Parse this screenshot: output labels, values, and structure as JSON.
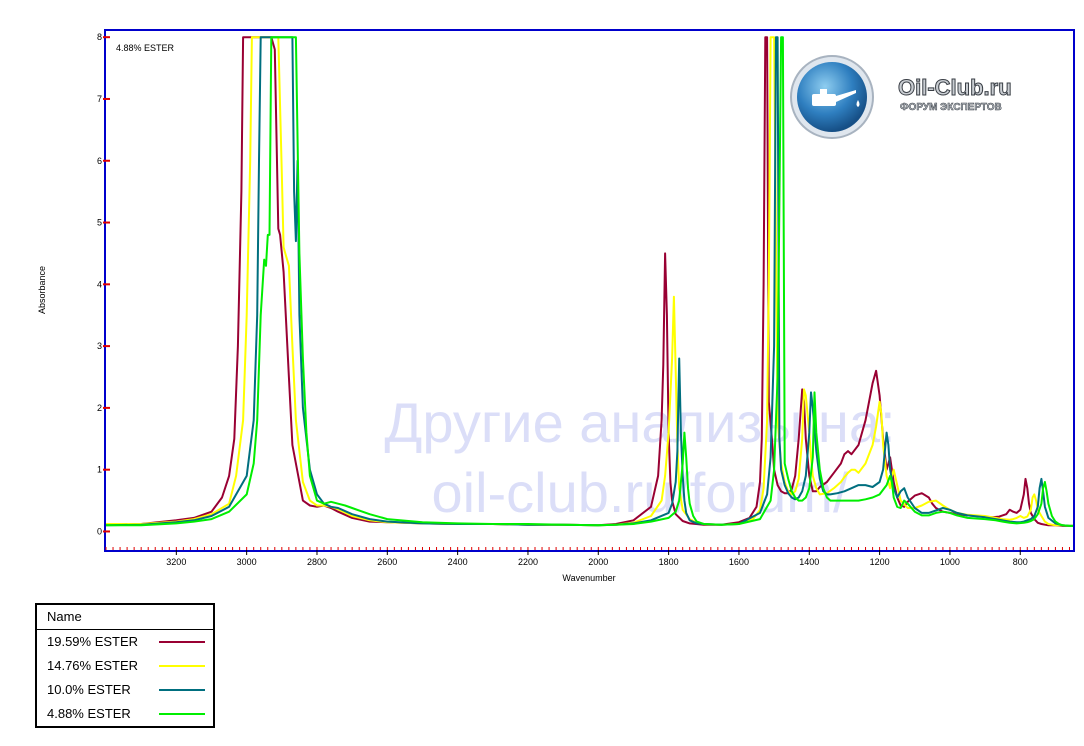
{
  "chart_data": {
    "type": "line",
    "subtitle": "4.88% ESTER",
    "xlabel": "Wavenumber",
    "ylabel": "Absorbance",
    "xlim": [
      3400,
      650
    ],
    "ylim": [
      -0.3,
      8.1
    ],
    "x_ticks": [
      3200,
      3000,
      2800,
      2600,
      2400,
      2200,
      2000,
      1800,
      1600,
      1400,
      1200,
      1000,
      800
    ],
    "y_ticks": [
      0,
      1,
      2,
      3,
      4,
      5,
      6,
      7,
      8
    ],
    "grid": false,
    "legend_title": "Name",
    "legend_position": "below-left",
    "watermark": [
      "Другие анализы на:",
      "oil-club.ru/forum/"
    ],
    "logo": {
      "name": "Oil-Club.ru",
      "tagline": "ФОРУМ ЭКСПЕРТОВ",
      "icon": "oil-can-icon"
    },
    "series": [
      {
        "name": "19.59% ESTER",
        "color": "#990033",
        "x": [
          3400,
          3300,
          3200,
          3150,
          3100,
          3070,
          3050,
          3035,
          3025,
          3015,
          3010,
          2930,
          2920,
          2910,
          2905,
          2895,
          2880,
          2870,
          2850,
          2840,
          2820,
          2800,
          2780,
          2760,
          2740,
          2700,
          2650,
          2600,
          2500,
          2400,
          2300,
          2200,
          2100,
          2000,
          1950,
          1900,
          1850,
          1830,
          1820,
          1815,
          1810,
          1805,
          1800,
          1795,
          1790,
          1780,
          1760,
          1740,
          1700,
          1650,
          1600,
          1570,
          1550,
          1540,
          1535,
          1530,
          1525,
          1520,
          1515,
          1505,
          1500,
          1490,
          1480,
          1470,
          1460,
          1450,
          1440,
          1430,
          1420,
          1415,
          1410,
          1400,
          1390,
          1380,
          1370,
          1350,
          1330,
          1310,
          1300,
          1290,
          1280,
          1260,
          1240,
          1220,
          1210,
          1200,
          1190,
          1180,
          1175,
          1170,
          1160,
          1150,
          1140,
          1130,
          1120,
          1100,
          1080,
          1060,
          1050,
          1040,
          1020,
          1000,
          980,
          950,
          900,
          880,
          860,
          840,
          830,
          820,
          810,
          800,
          790,
          785,
          780,
          775,
          770,
          760,
          750,
          740,
          730,
          720,
          700,
          680,
          660,
          650
        ],
        "y": [
          0.12,
          0.12,
          0.18,
          0.22,
          0.32,
          0.55,
          0.9,
          1.5,
          3.0,
          5.5,
          8,
          8,
          7.8,
          4.9,
          4.8,
          4.2,
          2.5,
          1.4,
          0.8,
          0.5,
          0.42,
          0.4,
          0.42,
          0.38,
          0.32,
          0.22,
          0.16,
          0.15,
          0.13,
          0.12,
          0.12,
          0.11,
          0.11,
          0.1,
          0.12,
          0.18,
          0.4,
          0.9,
          1.8,
          2.7,
          4.5,
          3.5,
          1.6,
          0.8,
          0.5,
          0.28,
          0.17,
          0.13,
          0.11,
          0.11,
          0.15,
          0.22,
          0.4,
          0.8,
          1.5,
          4.0,
          8,
          8,
          2.1,
          1.4,
          1.0,
          0.75,
          0.65,
          0.62,
          0.62,
          0.68,
          0.9,
          1.5,
          2.3,
          2.1,
          1.5,
          0.9,
          0.65,
          0.65,
          0.72,
          0.8,
          0.95,
          1.1,
          1.25,
          1.3,
          1.25,
          1.4,
          1.8,
          2.4,
          2.6,
          2.2,
          1.5,
          1.0,
          1.1,
          1.2,
          0.8,
          0.55,
          0.42,
          0.4,
          0.48,
          0.58,
          0.62,
          0.55,
          0.45,
          0.38,
          0.32,
          0.3,
          0.28,
          0.26,
          0.24,
          0.23,
          0.24,
          0.28,
          0.35,
          0.32,
          0.3,
          0.35,
          0.6,
          0.85,
          0.7,
          0.45,
          0.3,
          0.2,
          0.14,
          0.12,
          0.11,
          0.1,
          0.1,
          0.09,
          0.09,
          0.09
        ]
      },
      {
        "name": "14.76% ESTER",
        "color": "#ffff00",
        "x": [
          3400,
          3300,
          3200,
          3150,
          3100,
          3050,
          3030,
          3010,
          3000,
          2990,
          2985,
          2910,
          2900,
          2895,
          2890,
          2880,
          2870,
          2860,
          2840,
          2820,
          2800,
          2780,
          2760,
          2740,
          2700,
          2650,
          2600,
          2500,
          2400,
          2300,
          2200,
          2100,
          2000,
          1950,
          1900,
          1850,
          1820,
          1810,
          1800,
          1790,
          1785,
          1780,
          1775,
          1770,
          1760,
          1740,
          1720,
          1700,
          1650,
          1600,
          1560,
          1540,
          1530,
          1520,
          1515,
          1510,
          1500,
          1490,
          1480,
          1470,
          1460,
          1450,
          1440,
          1430,
          1420,
          1415,
          1410,
          1400,
          1395,
          1390,
          1380,
          1370,
          1350,
          1330,
          1310,
          1300,
          1290,
          1280,
          1270,
          1260,
          1240,
          1220,
          1210,
          1200,
          1195,
          1190,
          1180,
          1170,
          1165,
          1160,
          1150,
          1140,
          1120,
          1100,
          1080,
          1060,
          1040,
          1020,
          1000,
          980,
          950,
          900,
          870,
          850,
          830,
          820,
          810,
          800,
          790,
          780,
          770,
          765,
          760,
          755,
          750,
          740,
          730,
          720,
          700,
          680,
          660,
          650
        ],
        "y": [
          0.12,
          0.12,
          0.16,
          0.2,
          0.28,
          0.45,
          0.9,
          1.8,
          3.5,
          6.0,
          8,
          8,
          5.8,
          4.6,
          4.5,
          4.3,
          3.0,
          1.8,
          0.8,
          0.5,
          0.42,
          0.42,
          0.4,
          0.36,
          0.25,
          0.18,
          0.15,
          0.13,
          0.12,
          0.12,
          0.11,
          0.11,
          0.1,
          0.11,
          0.14,
          0.25,
          0.5,
          0.9,
          1.6,
          2.8,
          3.8,
          2.6,
          1.4,
          0.7,
          0.35,
          0.2,
          0.14,
          0.12,
          0.11,
          0.12,
          0.2,
          0.35,
          0.7,
          1.8,
          4.0,
          8,
          8,
          1.8,
          1.1,
          0.8,
          0.65,
          0.6,
          0.65,
          0.85,
          1.5,
          2.3,
          2.2,
          1.6,
          1.2,
          0.9,
          0.7,
          0.6,
          0.62,
          0.7,
          0.8,
          0.88,
          0.95,
          1.0,
          1.0,
          0.95,
          1.1,
          1.4,
          1.7,
          2.1,
          1.9,
          1.4,
          0.9,
          0.7,
          0.9,
          1.0,
          0.75,
          0.5,
          0.38,
          0.38,
          0.42,
          0.48,
          0.5,
          0.42,
          0.35,
          0.3,
          0.27,
          0.25,
          0.22,
          0.2,
          0.19,
          0.2,
          0.22,
          0.25,
          0.22,
          0.24,
          0.35,
          0.55,
          0.6,
          0.5,
          0.35,
          0.25,
          0.16,
          0.12,
          0.1,
          0.1,
          0.09,
          0.09
        ]
      },
      {
        "name": "10.0% ESTER",
        "color": "#006f7f",
        "x": [
          3400,
          3300,
          3200,
          3150,
          3100,
          3050,
          3000,
          2980,
          2970,
          2965,
          2960,
          2870,
          2865,
          2860,
          2855,
          2850,
          2840,
          2820,
          2800,
          2780,
          2760,
          2740,
          2700,
          2650,
          2600,
          2500,
          2400,
          2300,
          2200,
          2100,
          2000,
          1950,
          1900,
          1850,
          1800,
          1790,
          1780,
          1775,
          1770,
          1765,
          1760,
          1755,
          1750,
          1740,
          1720,
          1700,
          1650,
          1600,
          1540,
          1520,
          1510,
          1500,
          1495,
          1490,
          1485,
          1480,
          1470,
          1460,
          1450,
          1440,
          1430,
          1420,
          1410,
          1400,
          1395,
          1390,
          1380,
          1370,
          1360,
          1350,
          1340,
          1320,
          1300,
          1280,
          1260,
          1240,
          1220,
          1200,
          1190,
          1180,
          1175,
          1170,
          1160,
          1150,
          1140,
          1130,
          1120,
          1100,
          1080,
          1060,
          1040,
          1020,
          1000,
          980,
          950,
          900,
          870,
          850,
          830,
          810,
          800,
          790,
          780,
          770,
          760,
          750,
          745,
          740,
          735,
          730,
          720,
          700,
          680,
          660,
          650
        ],
        "y": [
          0.1,
          0.11,
          0.15,
          0.18,
          0.25,
          0.4,
          0.9,
          1.8,
          3.5,
          6.0,
          8,
          8,
          5.5,
          4.7,
          6.0,
          3.5,
          2.0,
          1.0,
          0.6,
          0.45,
          0.4,
          0.38,
          0.28,
          0.2,
          0.16,
          0.13,
          0.12,
          0.12,
          0.11,
          0.11,
          0.1,
          0.11,
          0.13,
          0.18,
          0.3,
          0.45,
          0.8,
          1.3,
          2.8,
          1.6,
          0.9,
          0.5,
          0.3,
          0.18,
          0.13,
          0.12,
          0.11,
          0.12,
          0.3,
          0.6,
          1.2,
          3.0,
          8,
          8,
          1.5,
          1.0,
          0.75,
          0.62,
          0.55,
          0.52,
          0.55,
          0.65,
          0.9,
          1.6,
          2.25,
          2.0,
          1.3,
          0.85,
          0.65,
          0.6,
          0.6,
          0.62,
          0.65,
          0.7,
          0.75,
          0.75,
          0.72,
          0.8,
          1.0,
          1.6,
          1.4,
          1.0,
          0.7,
          0.55,
          0.65,
          0.7,
          0.55,
          0.38,
          0.3,
          0.3,
          0.34,
          0.38,
          0.35,
          0.3,
          0.26,
          0.23,
          0.2,
          0.18,
          0.16,
          0.15,
          0.15,
          0.16,
          0.18,
          0.2,
          0.25,
          0.4,
          0.7,
          0.85,
          0.65,
          0.4,
          0.22,
          0.13,
          0.1,
          0.09,
          0.09
        ]
      },
      {
        "name": "4.88% ESTER",
        "color": "#00ee00",
        "x": [
          3400,
          3300,
          3200,
          3150,
          3100,
          3050,
          3000,
          2980,
          2970,
          2960,
          2950,
          2945,
          2940,
          2935,
          2930,
          2860,
          2850,
          2840,
          2830,
          2820,
          2800,
          2780,
          2760,
          2740,
          2720,
          2700,
          2650,
          2600,
          2500,
          2400,
          2300,
          2200,
          2100,
          2000,
          1950,
          1900,
          1850,
          1800,
          1780,
          1770,
          1765,
          1760,
          1755,
          1750,
          1745,
          1740,
          1730,
          1720,
          1700,
          1650,
          1600,
          1540,
          1510,
          1500,
          1490,
          1480,
          1475,
          1470,
          1460,
          1450,
          1440,
          1430,
          1420,
          1410,
          1400,
          1390,
          1385,
          1380,
          1370,
          1360,
          1350,
          1340,
          1320,
          1300,
          1280,
          1260,
          1240,
          1220,
          1200,
          1180,
          1170,
          1165,
          1160,
          1150,
          1140,
          1130,
          1120,
          1100,
          1080,
          1060,
          1040,
          1020,
          1000,
          980,
          950,
          900,
          870,
          850,
          830,
          810,
          790,
          780,
          770,
          760,
          750,
          740,
          735,
          730,
          725,
          720,
          710,
          700,
          690,
          680,
          660,
          650
        ],
        "y": [
          0.1,
          0.1,
          0.13,
          0.16,
          0.2,
          0.32,
          0.6,
          1.1,
          1.8,
          3.5,
          4.4,
          4.3,
          4.8,
          4.8,
          8,
          8,
          4.5,
          2.8,
          1.6,
          0.9,
          0.5,
          0.45,
          0.48,
          0.45,
          0.42,
          0.38,
          0.28,
          0.2,
          0.15,
          0.13,
          0.12,
          0.12,
          0.11,
          0.1,
          0.11,
          0.12,
          0.16,
          0.22,
          0.32,
          0.5,
          0.8,
          1.1,
          1.6,
          1.2,
          0.7,
          0.45,
          0.25,
          0.16,
          0.12,
          0.11,
          0.12,
          0.2,
          0.5,
          1.0,
          2.5,
          8,
          8,
          1.1,
          0.85,
          0.65,
          0.55,
          0.5,
          0.5,
          0.55,
          0.7,
          1.2,
          2.25,
          1.6,
          1.0,
          0.7,
          0.55,
          0.5,
          0.5,
          0.5,
          0.5,
          0.5,
          0.52,
          0.55,
          0.6,
          0.75,
          0.9,
          0.8,
          0.55,
          0.4,
          0.38,
          0.5,
          0.45,
          0.32,
          0.26,
          0.26,
          0.3,
          0.32,
          0.3,
          0.26,
          0.22,
          0.2,
          0.18,
          0.16,
          0.14,
          0.13,
          0.14,
          0.15,
          0.17,
          0.2,
          0.28,
          0.45,
          0.7,
          0.8,
          0.65,
          0.45,
          0.25,
          0.16,
          0.12,
          0.1,
          0.09,
          0.09
        ]
      }
    ]
  }
}
